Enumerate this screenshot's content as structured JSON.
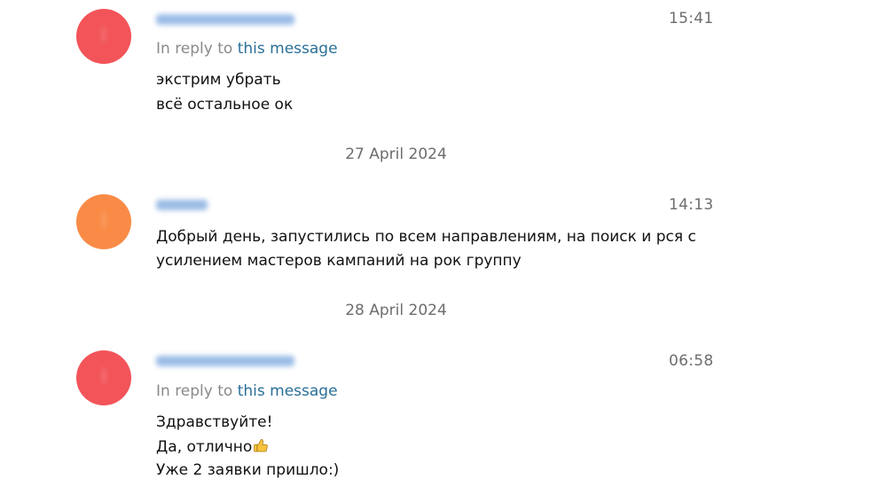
{
  "messages": [
    {
      "avatar_color": "#f25459",
      "name_color": "#7aa6de",
      "time": "15:41",
      "reply": {
        "prefix": "In reply to",
        "link": "this message"
      },
      "lines": [
        "экстрим убрать",
        "всё остальное ок"
      ]
    },
    {
      "avatar_color": "#f98b46",
      "name_color": "#7aa6de",
      "time": "14:13",
      "lines": [
        "Добрый день, запустились по всем направлениям, на поиск и рся с",
        "усилением мастеров кампаний на рок группу"
      ]
    },
    {
      "avatar_color": "#f25459",
      "name_color": "#7aa6de",
      "time": "06:58",
      "reply": {
        "prefix": "In reply to",
        "link": "this message"
      },
      "lines": [
        "Здравствуйте!",
        "Да, отлично",
        "Уже 2 заявки пришло:)"
      ],
      "emoji": "thumbs-up"
    }
  ],
  "date_separators": [
    "27 April 2024",
    "28 April 2024"
  ]
}
